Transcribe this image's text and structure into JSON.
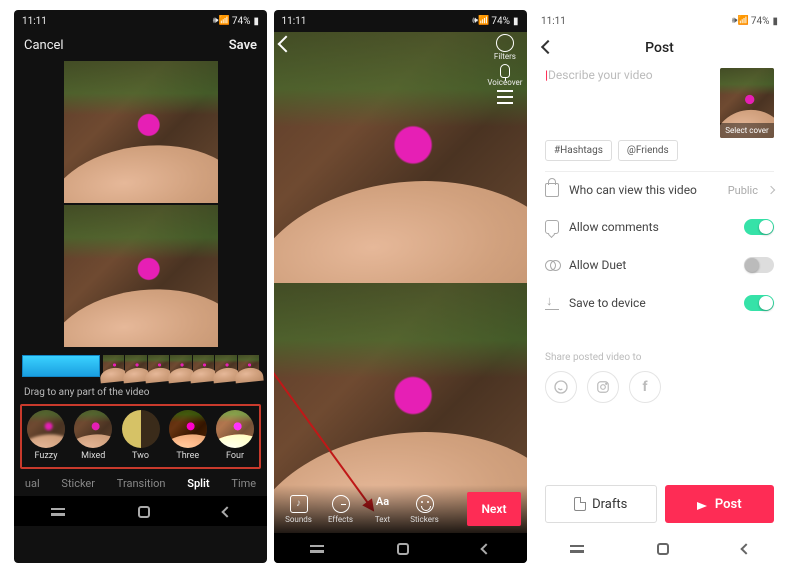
{
  "status": {
    "time": "11:11",
    "icon": "🎥",
    "signals": "📶 📶 ⚡",
    "battery": "74%"
  },
  "panel1": {
    "cancel": "Cancel",
    "save": "Save",
    "drag_hint": "Drag to any part of the video",
    "filters": [
      {
        "name": "Fuzzy"
      },
      {
        "name": "Mixed"
      },
      {
        "name": "Two"
      },
      {
        "name": "Three"
      },
      {
        "name": "Four"
      }
    ],
    "tabs": {
      "visual": "ual",
      "sticker": "Sticker",
      "transition": "Transition",
      "split": "Split",
      "time": "Time"
    },
    "active_tab": "split"
  },
  "panel2": {
    "side": {
      "filters": "Filters",
      "voiceover": "Voiceover"
    },
    "tools": {
      "sounds": "Sounds",
      "effects": "Effects",
      "text": "Text",
      "stickers": "Stickers"
    },
    "next": "Next"
  },
  "panel3": {
    "title": "Post",
    "placeholder": "Describe your video",
    "select_cover": "Select cover",
    "chips": {
      "hashtags": "#Hashtags",
      "friends": "@Friends"
    },
    "settings": {
      "privacy": {
        "label": "Who can view this video",
        "value": "Public"
      },
      "comments": {
        "label": "Allow comments",
        "on": true
      },
      "duet": {
        "label": "Allow Duet",
        "on": false
      },
      "save": {
        "label": "Save to device",
        "on": true
      }
    },
    "share_label": "Share posted video to",
    "buttons": {
      "drafts": "Drafts",
      "post": "Post"
    }
  }
}
